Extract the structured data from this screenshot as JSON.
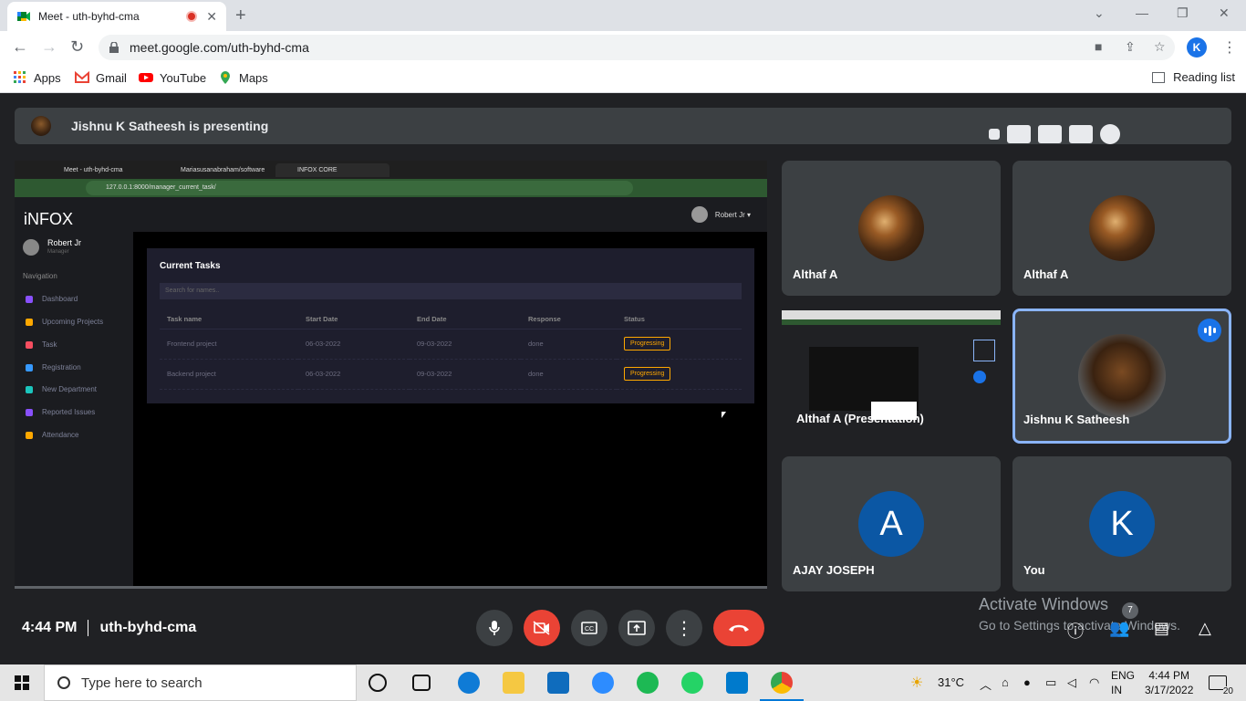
{
  "browser": {
    "tab_title": "Meet - uth-byhd-cma",
    "url": "meet.google.com/uth-byhd-cma",
    "profile_initial": "K",
    "bookmarks": [
      "Apps",
      "Gmail",
      "YouTube",
      "Maps"
    ],
    "reading_list": "Reading list"
  },
  "meet": {
    "presenting_banner": "Jishnu K Satheesh is presenting",
    "meeting_time": "4:44 PM",
    "meeting_code": "uth-byhd-cma",
    "participant_count": "7",
    "tiles": [
      {
        "name": "Althaf A",
        "type": "photo"
      },
      {
        "name": "Althaf A",
        "type": "photo"
      },
      {
        "name": "Althaf A (Presentation)",
        "type": "presentation"
      },
      {
        "name": "Jishnu K Satheesh",
        "type": "photo",
        "speaking": true
      },
      {
        "name": "AJAY JOSEPH",
        "type": "letter",
        "letter": "A",
        "color": "#0b57a4"
      },
      {
        "name": "You",
        "type": "letter",
        "letter": "K",
        "color": "#0b57a4"
      }
    ],
    "activate_title": "Activate Windows",
    "activate_sub": "Go to Settings to activate Windows."
  },
  "shared_screen": {
    "tabs": [
      "Meet - uth-byhd-cma",
      "Mariasusanabraham/software",
      "INFOX CORE"
    ],
    "url": "127.0.0.1:8000/manager_current_task/",
    "brand": "iNFOX",
    "user_name": "Robert Jr",
    "user_role": "Manager",
    "topbar_user": "Robert Jr",
    "nav_heading": "Navigation",
    "nav_items": [
      {
        "label": "Dashboard",
        "color": "#8950fc"
      },
      {
        "label": "Upcoming Projects",
        "color": "#ffa800"
      },
      {
        "label": "Task",
        "color": "#f64e60"
      },
      {
        "label": "Registration",
        "color": "#3699ff"
      },
      {
        "label": "New Department",
        "color": "#1bc5bd"
      },
      {
        "label": "Reported Issues",
        "color": "#8950fc"
      },
      {
        "label": "Attendance",
        "color": "#ffa800"
      }
    ],
    "card_title": "Current Tasks",
    "search_placeholder": "Search for names..",
    "columns": [
      "Task name",
      "Start Date",
      "End Date",
      "Response",
      "Status"
    ],
    "rows": [
      [
        "Frontend project",
        "06-03-2022",
        "09-03-2022",
        "done",
        "Progressing"
      ],
      [
        "Backend project",
        "06-03-2022",
        "09-03-2022",
        "done",
        "Progressing"
      ]
    ]
  },
  "taskbar": {
    "search_placeholder": "Type here to search",
    "temperature": "31°C",
    "lang_line1": "ENG",
    "lang_line2": "IN",
    "time": "4:44 PM",
    "date": "3/17/2022",
    "notification_count": "20"
  }
}
